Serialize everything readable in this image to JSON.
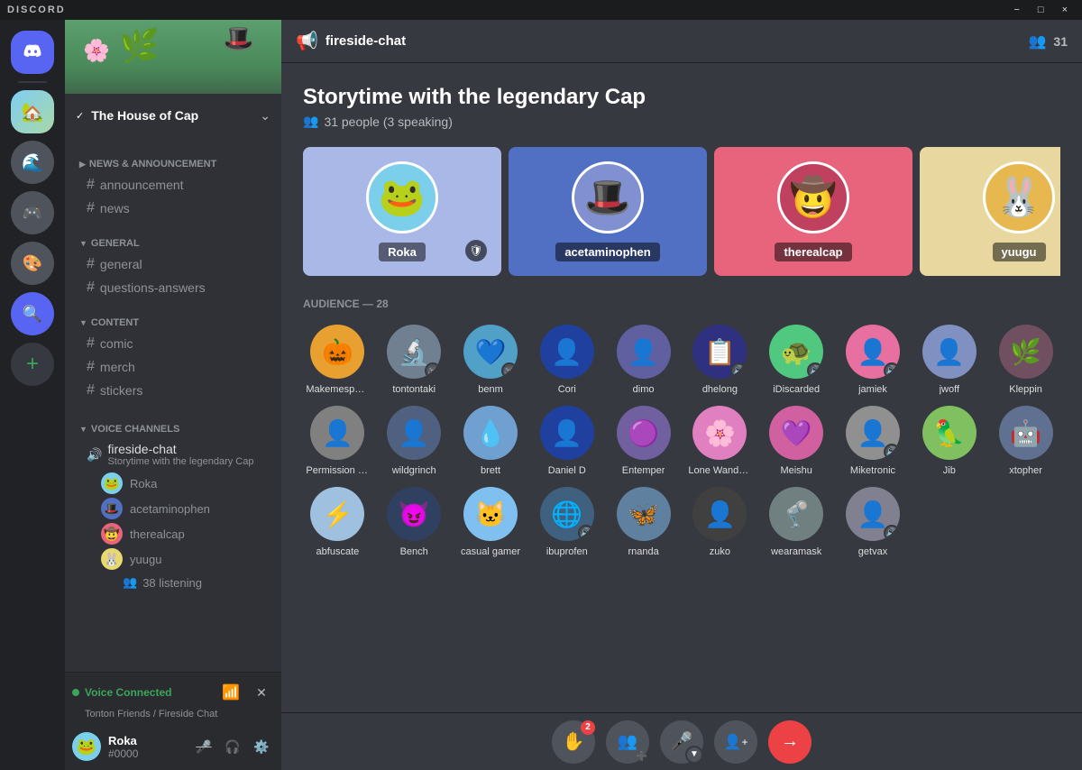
{
  "titlebar": {
    "title": "DISCORD",
    "controls": [
      "−",
      "□",
      "×"
    ]
  },
  "server": {
    "name": "The House of Cap",
    "chevron": "⌄"
  },
  "channels": {
    "news_announcement": {
      "category": "NEWS & ANNOUNCEMENT",
      "items": [
        "announcement",
        "news"
      ]
    },
    "general": {
      "category": "GENERAL",
      "items": [
        "general",
        "questions-answers"
      ]
    },
    "content": {
      "category": "CONTENT",
      "items": [
        "comic",
        "merch",
        "stickers"
      ]
    },
    "voice": {
      "category": "VOICE CHANNELS",
      "channels": [
        {
          "name": "fireside-chat",
          "subtitle": "Storytime with the legendary Cap"
        }
      ],
      "users": [
        "Roka",
        "acetaminophen",
        "therealcap",
        "yuugu"
      ],
      "listening": "38 listening"
    }
  },
  "header": {
    "channel_name": "fireside-chat",
    "members_count": "31"
  },
  "stage": {
    "title": "Storytime with the legendary Cap",
    "subtitle": "31 people (3 speaking)",
    "speakers": [
      {
        "name": "Roka",
        "card_class": "speaker-card-1",
        "emoji": "🐸"
      },
      {
        "name": "acetaminophen",
        "card_class": "speaker-card-2",
        "emoji": "🎩"
      },
      {
        "name": "therealcap",
        "card_class": "speaker-card-3",
        "emoji": "🤠"
      },
      {
        "name": "yuugu",
        "card_class": "speaker-card-4",
        "emoji": "🐰"
      }
    ],
    "audience_count": "28",
    "audience": [
      {
        "name": "Makemespeakrr",
        "emoji": "🎃",
        "badge": ""
      },
      {
        "name": "tontontaki",
        "emoji": "🔬",
        "badge": "🎮"
      },
      {
        "name": "benm",
        "emoji": "💙",
        "badge": "🎮"
      },
      {
        "name": "Cori",
        "emoji": "👤",
        "badge": ""
      },
      {
        "name": "dimo",
        "emoji": "👤",
        "badge": ""
      },
      {
        "name": "dhelong",
        "emoji": "📋",
        "badge": "🔊"
      },
      {
        "name": "iDiscarded",
        "emoji": "🐢",
        "badge": "🔊"
      },
      {
        "name": "jamiek",
        "emoji": "👤",
        "badge": "🔊"
      },
      {
        "name": "jwoff",
        "emoji": "👤",
        "badge": ""
      },
      {
        "name": "Kleppin",
        "emoji": "🌿",
        "badge": ""
      },
      {
        "name": "Permission Man",
        "emoji": "👤",
        "badge": ""
      },
      {
        "name": "wildgrinch",
        "emoji": "👤",
        "badge": ""
      },
      {
        "name": "brett",
        "emoji": "💧",
        "badge": ""
      },
      {
        "name": "Daniel D",
        "emoji": "👤",
        "badge": ""
      },
      {
        "name": "Entemper",
        "emoji": "🟣",
        "badge": ""
      },
      {
        "name": "Lone Wanderer",
        "emoji": "🌸",
        "badge": ""
      },
      {
        "name": "Meishu",
        "emoji": "💜",
        "badge": ""
      },
      {
        "name": "Miketronic",
        "emoji": "👤",
        "badge": "🔊"
      },
      {
        "name": "Jib",
        "emoji": "🦜",
        "badge": ""
      },
      {
        "name": "xtopher",
        "emoji": "🤖",
        "badge": ""
      },
      {
        "name": "abfuscate",
        "emoji": "⚡",
        "badge": ""
      },
      {
        "name": "Bench",
        "emoji": "😈",
        "badge": ""
      },
      {
        "name": "casual gamer",
        "emoji": "🐱",
        "badge": ""
      },
      {
        "name": "ibuprofen",
        "emoji": "🌐",
        "badge": "🔊"
      },
      {
        "name": "rnanda",
        "emoji": "🦋",
        "badge": ""
      },
      {
        "name": "zuko",
        "emoji": "👤",
        "badge": ""
      },
      {
        "name": "wearamask",
        "emoji": "🦿",
        "badge": ""
      },
      {
        "name": "getvax",
        "emoji": "👤",
        "badge": "🔊"
      }
    ]
  },
  "toolbar": {
    "raise_hand_badge": "2",
    "invite_label": "👥",
    "mic_label": "🎤",
    "add_label": "👤",
    "leave_label": "→"
  },
  "voice_connected": {
    "status": "Voice Connected",
    "location": "Tonton Friends / Fireside Chat"
  },
  "user": {
    "name": "Roka",
    "tag": "#0000"
  },
  "colors": {
    "accent": "#5865f2",
    "green": "#3ba55c",
    "danger": "#ed4245",
    "bg_dark": "#202225",
    "bg_mid": "#2f3136",
    "bg_light": "#36393f"
  }
}
